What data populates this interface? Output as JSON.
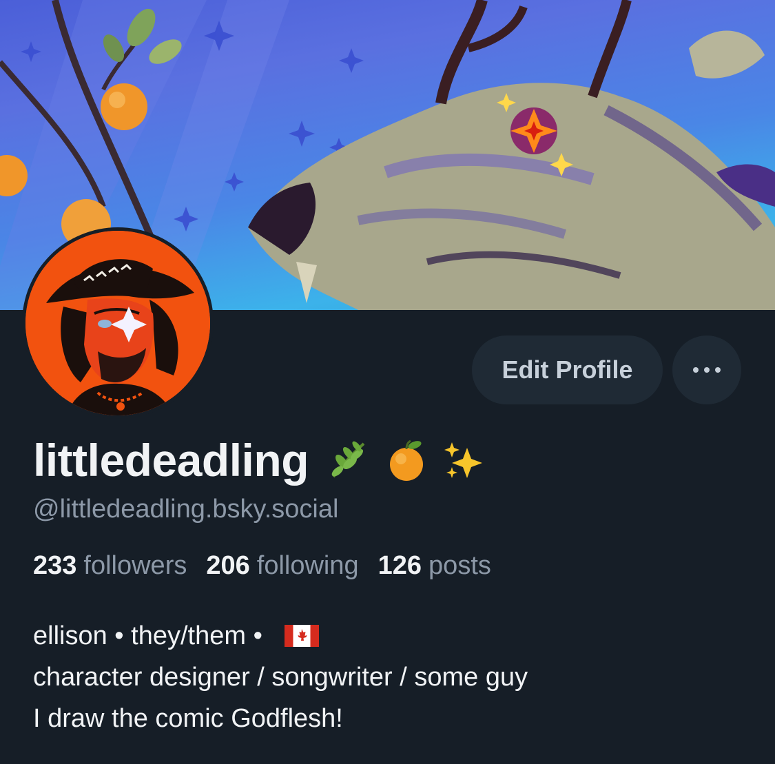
{
  "profile": {
    "display_name": "littledeadling",
    "name_emojis": [
      "herb-emoji",
      "tangerine-emoji",
      "sparkles-emoji"
    ],
    "handle": "@littledeadling.bsky.social",
    "stats": {
      "followers_count": "233",
      "followers_label": "followers",
      "following_count": "206",
      "following_label": "following",
      "posts_count": "126",
      "posts_label": "posts"
    },
    "bio": {
      "line1": "ellison • they/them • ",
      "line1_flag": "canada-flag",
      "line2": "character designer / songwriter / some guy",
      "line3": "I draw the comic Godflesh!"
    }
  },
  "actions": {
    "edit_profile_label": "Edit Profile",
    "more_icon": "more-options-icon"
  },
  "colors": {
    "background": "#161e27",
    "button_bg": "#1f2a35",
    "secondary_text": "#8d99a8",
    "primary_text": "#f1f3f5",
    "avatar_bg": "#f2520f"
  }
}
